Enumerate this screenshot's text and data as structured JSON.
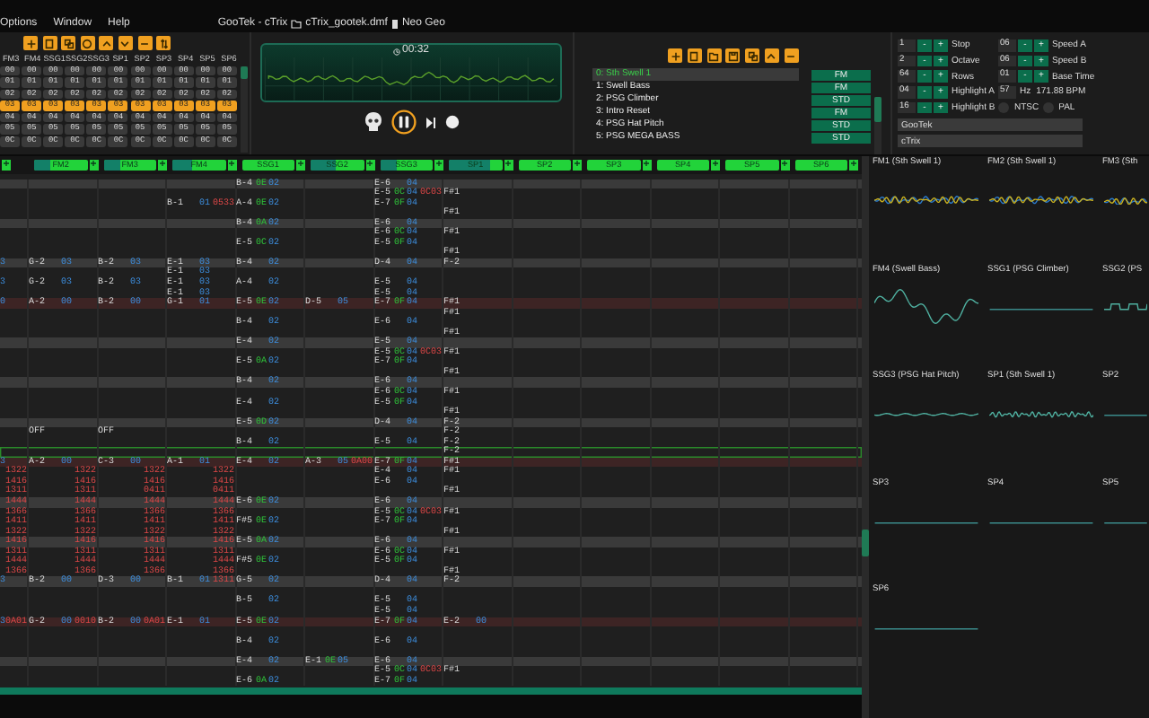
{
  "menu": [
    "Options",
    "Window",
    "Help"
  ],
  "title": {
    "song": "GooTek - cTrix",
    "file": "cTrix_gootek.dmf",
    "system": "Neo Geo"
  },
  "orders": {
    "columns": [
      "FM3",
      "FM4",
      "SSG1",
      "SSG2",
      "SSG3",
      "SP1",
      "SP2",
      "SP3",
      "SP4",
      "SP5",
      "SP6"
    ],
    "rows": [
      {
        "selected": false,
        "cells": [
          "00",
          "00",
          "00",
          "00",
          "00",
          "00",
          "00",
          "00",
          "00",
          "00",
          "00"
        ]
      },
      {
        "selected": false,
        "cells": [
          "01",
          "01",
          "01",
          "01",
          "01",
          "01",
          "01",
          "01",
          "01",
          "01",
          "01"
        ]
      },
      {
        "selected": false,
        "cells": [
          "02",
          "02",
          "02",
          "02",
          "02",
          "02",
          "02",
          "02",
          "02",
          "02",
          "02"
        ]
      },
      {
        "selected": true,
        "cells": [
          "03",
          "03",
          "03",
          "03",
          "03",
          "03",
          "03",
          "03",
          "03",
          "03",
          "03"
        ]
      },
      {
        "selected": false,
        "cells": [
          "04",
          "04",
          "04",
          "04",
          "04",
          "04",
          "04",
          "04",
          "04",
          "04",
          "04"
        ]
      },
      {
        "selected": false,
        "cells": [
          "05",
          "05",
          "05",
          "05",
          "05",
          "05",
          "05",
          "05",
          "05",
          "05",
          "05"
        ]
      },
      {
        "selected": false,
        "cells": [
          "0C",
          "0C",
          "0C",
          "0C",
          "0C",
          "0C",
          "0C",
          "0C",
          "0C",
          "0C",
          "0C"
        ]
      }
    ]
  },
  "oscilloscope": {
    "time": "00:32"
  },
  "transport": {
    "playing": true
  },
  "instruments": [
    {
      "name": "0: Sth Swell 1",
      "type": "FM",
      "selected": true
    },
    {
      "name": "1: Swell Bass",
      "type": "FM",
      "selected": false
    },
    {
      "name": "2: PSG Climber",
      "type": "STD",
      "selected": false
    },
    {
      "name": "3: Intro Reset",
      "type": "FM",
      "selected": false
    },
    {
      "name": "4: PSG Hat Pitch",
      "type": "STD",
      "selected": false
    },
    {
      "name": "5: PSG MEGA BASS",
      "type": "STD",
      "selected": false
    }
  ],
  "settings": {
    "left": [
      {
        "value": "1",
        "label": "Stop"
      },
      {
        "value": "2",
        "label": "Octave"
      },
      {
        "value": "64",
        "label": "Rows"
      },
      {
        "value": "04",
        "label": "Highlight A"
      },
      {
        "value": "16",
        "label": "Highlight B"
      }
    ],
    "right": [
      {
        "kind": "spin",
        "value": "06",
        "label": "Speed A"
      },
      {
        "kind": "spin",
        "value": "06",
        "label": "Speed B"
      },
      {
        "kind": "spin",
        "value": "01",
        "label": "Base Time"
      },
      {
        "kind": "rate",
        "value": "57",
        "unit": "Hz",
        "reading": "171.88 BPM"
      },
      {
        "kind": "radios",
        "options": [
          {
            "label": "NTSC",
            "selected": false
          },
          {
            "label": "PAL",
            "selected": false
          }
        ]
      }
    ],
    "minus": "-",
    "plus": "+",
    "author": "GooTek",
    "name_field": "cTrix"
  },
  "channels": [
    {
      "add": "+"
    },
    {
      "label": "FM2",
      "add": "+",
      "level": 0.3
    },
    {
      "label": "FM3",
      "add": "+",
      "level": 0.3
    },
    {
      "label": "FM4",
      "add": "+",
      "level": 0.35
    },
    {
      "label": "SSG1",
      "add": "+",
      "level": 0
    },
    {
      "label": "SSG2",
      "add": "+",
      "level": 0.45
    },
    {
      "label": "SSG3",
      "add": "+",
      "level": 0.3
    },
    {
      "label": "SP1",
      "add": "+",
      "level": 0.75
    },
    {
      "label": "SP2",
      "add": "+",
      "level": 0
    },
    {
      "label": "SP3",
      "add": "+",
      "level": 0
    },
    {
      "label": "SP4",
      "add": "+",
      "level": 0
    },
    {
      "label": "SP5",
      "add": "+",
      "level": 0
    },
    {
      "label": "SP6",
      "add": "+",
      "level": 0
    }
  ],
  "pattern": [
    {
      "kind": "beat",
      "playing": false,
      "cells": [
        null,
        null,
        null,
        null,
        {
          "note": "B-4",
          "instrument": "0E",
          "volume": "02"
        },
        null,
        {
          "note": "E-6",
          "volume": "04"
        }
      ]
    },
    {
      "kind": "normal",
      "playing": false,
      "cells": [
        null,
        null,
        null,
        null,
        null,
        null,
        {
          "note": "E-5",
          "instrument": "0C",
          "volume": "04",
          "effect": "0C03"
        },
        {
          "note": "F#1"
        }
      ]
    },
    {
      "kind": "normal",
      "playing": false,
      "cells": [
        null,
        null,
        null,
        {
          "note": "B-1",
          "volume": "01",
          "effect": "0533"
        },
        {
          "note": "A-4",
          "instrument": "0E",
          "volume": "02"
        },
        null,
        {
          "note": "E-7",
          "instrument": "0F",
          "volume": "04"
        }
      ]
    },
    {
      "kind": "normal",
      "playing": false,
      "cells": [
        null,
        null,
        null,
        null,
        null,
        null,
        null,
        {
          "note": "F#1"
        }
      ]
    },
    {
      "kind": "beat",
      "playing": false,
      "cells": [
        null,
        null,
        null,
        null,
        {
          "note": "B-4",
          "instrument": "0A",
          "volume": "02"
        },
        null,
        {
          "note": "E-6",
          "volume": "04"
        }
      ]
    },
    {
      "kind": "normal",
      "playing": false,
      "cells": [
        null,
        null,
        null,
        null,
        null,
        null,
        {
          "note": "E-6",
          "instrument": "0C",
          "volume": "04"
        },
        {
          "note": "F#1"
        }
      ]
    },
    {
      "kind": "normal",
      "playing": false,
      "cells": [
        null,
        null,
        null,
        null,
        {
          "note": "E-5",
          "instrument": "0C",
          "volume": "02"
        },
        null,
        {
          "note": "E-5",
          "instrument": "0F",
          "volume": "04"
        }
      ]
    },
    {
      "kind": "normal",
      "playing": false,
      "cells": [
        null,
        null,
        null,
        null,
        null,
        null,
        null,
        {
          "note": "F#1"
        }
      ]
    },
    {
      "kind": "beat",
      "playing": false,
      "cells": [
        {
          "volume": "3"
        },
        {
          "note": "G-2",
          "volume": "03"
        },
        {
          "note": "B-2",
          "volume": "03"
        },
        {
          "note": "E-1",
          "volume": "03"
        },
        {
          "note": "B-4",
          "volume": "02"
        },
        null,
        {
          "note": "D-4",
          "volume": "04"
        },
        {
          "note": "F-2"
        }
      ]
    },
    {
      "kind": "normal",
      "playing": false,
      "cells": [
        null,
        null,
        null,
        {
          "note": "E-1",
          "volume": "03"
        }
      ]
    },
    {
      "kind": "normal",
      "playing": false,
      "cells": [
        {
          "volume": "3"
        },
        {
          "note": "G-2",
          "volume": "03"
        },
        {
          "note": "B-2",
          "volume": "03"
        },
        {
          "note": "E-1",
          "volume": "03"
        },
        {
          "note": "A-4",
          "volume": "02"
        },
        null,
        {
          "note": "E-5",
          "volume": "04"
        }
      ]
    },
    {
      "kind": "normal",
      "playing": false,
      "cells": [
        null,
        null,
        null,
        {
          "note": "E-1",
          "volume": "03"
        },
        null,
        null,
        {
          "note": "E-5",
          "volume": "04"
        }
      ]
    },
    {
      "kind": "bar",
      "playing": false,
      "cells": [
        {
          "volume": "0"
        },
        {
          "note": "A-2",
          "volume": "00"
        },
        {
          "note": "B-2",
          "volume": "00"
        },
        {
          "note": "G-1",
          "volume": "01"
        },
        {
          "note": "E-5",
          "instrument": "0E",
          "volume": "02"
        },
        {
          "note": "D-5",
          "volume": "05"
        },
        {
          "note": "E-7",
          "instrument": "0F",
          "volume": "04"
        },
        {
          "note": "F#1"
        }
      ]
    },
    {
      "kind": "normal",
      "playing": false,
      "cells": [
        null,
        null,
        null,
        null,
        null,
        null,
        null,
        {
          "note": "F#1"
        }
      ]
    },
    {
      "kind": "normal",
      "playing": false,
      "cells": [
        null,
        null,
        null,
        null,
        {
          "note": "B-4",
          "volume": "02"
        },
        null,
        {
          "note": "E-6",
          "volume": "04"
        }
      ]
    },
    {
      "kind": "normal",
      "playing": false,
      "cells": [
        null,
        null,
        null,
        null,
        null,
        null,
        null,
        {
          "note": "F#1"
        }
      ]
    },
    {
      "kind": "beat",
      "playing": false,
      "cells": [
        null,
        null,
        null,
        null,
        {
          "note": "E-4",
          "volume": "02"
        },
        null,
        {
          "note": "E-5",
          "volume": "04"
        }
      ]
    },
    {
      "kind": "normal",
      "playing": false,
      "cells": [
        null,
        null,
        null,
        null,
        null,
        null,
        {
          "note": "E-5",
          "instrument": "0C",
          "volume": "04",
          "effect": "0C03"
        },
        {
          "note": "F#1"
        }
      ]
    },
    {
      "kind": "normal",
      "playing": false,
      "cells": [
        null,
        null,
        null,
        null,
        {
          "note": "E-5",
          "instrument": "0A",
          "volume": "02"
        },
        null,
        {
          "note": "E-7",
          "instrument": "0F",
          "volume": "04"
        }
      ]
    },
    {
      "kind": "normal",
      "playing": false,
      "cells": [
        null,
        null,
        null,
        null,
        null,
        null,
        null,
        {
          "note": "F#1"
        }
      ]
    },
    {
      "kind": "beat",
      "playing": false,
      "cells": [
        null,
        null,
        null,
        null,
        {
          "note": "B-4",
          "volume": "02"
        },
        null,
        {
          "note": "E-6",
          "volume": "04"
        }
      ]
    },
    {
      "kind": "normal",
      "playing": false,
      "cells": [
        null,
        null,
        null,
        null,
        null,
        null,
        {
          "note": "E-6",
          "instrument": "0C",
          "volume": "04"
        },
        {
          "note": "F#1"
        }
      ]
    },
    {
      "kind": "normal",
      "playing": false,
      "cells": [
        null,
        null,
        null,
        null,
        {
          "note": "E-4",
          "volume": "02"
        },
        null,
        {
          "note": "E-5",
          "instrument": "0F",
          "volume": "04"
        }
      ]
    },
    {
      "kind": "normal",
      "playing": false,
      "cells": [
        null,
        null,
        null,
        null,
        null,
        null,
        null,
        {
          "note": "F#1"
        }
      ]
    },
    {
      "kind": "beat",
      "playing": false,
      "cells": [
        null,
        null,
        null,
        null,
        {
          "note": "E-5",
          "instrument": "0D",
          "volume": "02"
        },
        null,
        {
          "note": "D-4",
          "volume": "04"
        },
        {
          "note": "F-2"
        }
      ]
    },
    {
      "kind": "normal",
      "playing": false,
      "cells": [
        null,
        {
          "note": "OFF"
        },
        {
          "note": "OFF"
        },
        null,
        null,
        null,
        null,
        {
          "note": "F-2"
        }
      ]
    },
    {
      "kind": "normal",
      "playing": false,
      "cells": [
        null,
        null,
        null,
        null,
        {
          "note": "B-4",
          "volume": "02"
        },
        null,
        {
          "note": "E-5",
          "volume": "04"
        },
        {
          "note": "F-2"
        }
      ]
    },
    {
      "kind": "normal",
      "playing": true,
      "cells": [
        null,
        null,
        null,
        null,
        null,
        null,
        null,
        {
          "note": "F-2"
        }
      ]
    },
    {
      "kind": "bar",
      "playing": false,
      "cells": [
        {
          "volume": "3"
        },
        {
          "note": "A-2",
          "volume": "00"
        },
        {
          "note": "C-3",
          "volume": "00"
        },
        {
          "note": "A-1",
          "volume": "01"
        },
        {
          "note": "E-4",
          "volume": "02"
        },
        {
          "note": "A-3",
          "volume": "05",
          "effect": "0A00"
        },
        {
          "note": "E-7",
          "instrument": "0F",
          "volume": "04"
        },
        {
          "note": "F#1"
        }
      ]
    },
    {
      "kind": "normal",
      "playing": false,
      "cells": [
        {
          "effect": "1322"
        },
        {
          "effect": "1322"
        },
        {
          "effect": "1322"
        },
        {
          "effect": "1322"
        },
        null,
        null,
        {
          "note": "E-4",
          "volume": "04"
        },
        {
          "note": "F#1"
        }
      ]
    },
    {
      "kind": "normal",
      "playing": false,
      "cells": [
        {
          "effect": "1416"
        },
        {
          "effect": "1416"
        },
        {
          "effect": "1416"
        },
        {
          "effect": "1416"
        },
        null,
        null,
        {
          "note": "E-6",
          "volume": "04"
        }
      ]
    },
    {
      "kind": "normal",
      "playing": false,
      "cells": [
        {
          "effect": "1311"
        },
        {
          "effect": "1311"
        },
        {
          "effect": "0411"
        },
        {
          "effect": "0411"
        },
        null,
        null,
        null,
        {
          "note": "F#1"
        }
      ]
    },
    {
      "kind": "beat",
      "playing": false,
      "cells": [
        {
          "effect": "1444"
        },
        {
          "effect": "1444"
        },
        {
          "effect": "1444"
        },
        {
          "effect": "1444"
        },
        {
          "note": "E-6",
          "instrument": "0E",
          "volume": "02"
        },
        null,
        {
          "note": "E-6",
          "volume": "04"
        }
      ]
    },
    {
      "kind": "normal",
      "playing": false,
      "cells": [
        {
          "effect": "1366"
        },
        {
          "effect": "1366"
        },
        {
          "effect": "1366"
        },
        {
          "effect": "1366"
        },
        null,
        null,
        {
          "note": "E-5",
          "instrument": "0C",
          "volume": "04",
          "effect": "0C03"
        },
        {
          "note": "F#1"
        }
      ]
    },
    {
      "kind": "normal",
      "playing": false,
      "cells": [
        {
          "effect": "1411"
        },
        {
          "effect": "1411"
        },
        {
          "effect": "1411"
        },
        {
          "effect": "1411"
        },
        {
          "note": "F#5",
          "instrument": "0E",
          "volume": "02"
        },
        null,
        {
          "note": "E-7",
          "instrument": "0F",
          "volume": "04"
        }
      ]
    },
    {
      "kind": "normal",
      "playing": false,
      "cells": [
        {
          "effect": "1322"
        },
        {
          "effect": "1322"
        },
        {
          "effect": "1322"
        },
        {
          "effect": "1322"
        },
        null,
        null,
        null,
        {
          "note": "F#1"
        }
      ]
    },
    {
      "kind": "beat",
      "playing": false,
      "cells": [
        {
          "effect": "1416"
        },
        {
          "effect": "1416"
        },
        {
          "effect": "1416"
        },
        {
          "effect": "1416"
        },
        {
          "note": "E-5",
          "instrument": "0A",
          "volume": "02"
        },
        null,
        {
          "note": "E-6",
          "volume": "04"
        }
      ]
    },
    {
      "kind": "normal",
      "playing": false,
      "cells": [
        {
          "effect": "1311"
        },
        {
          "effect": "1311"
        },
        {
          "effect": "1311"
        },
        {
          "effect": "1311"
        },
        null,
        null,
        {
          "note": "E-6",
          "instrument": "0C",
          "volume": "04"
        },
        {
          "note": "F#1"
        }
      ]
    },
    {
      "kind": "normal",
      "playing": false,
      "cells": [
        {
          "effect": "1444"
        },
        {
          "effect": "1444"
        },
        {
          "effect": "1444"
        },
        {
          "effect": "1444"
        },
        {
          "note": "F#5",
          "instrument": "0E",
          "volume": "02"
        },
        null,
        {
          "note": "E-5",
          "instrument": "0F",
          "volume": "04"
        }
      ]
    },
    {
      "kind": "normal",
      "playing": false,
      "cells": [
        {
          "effect": "1366"
        },
        {
          "effect": "1366"
        },
        {
          "effect": "1366"
        },
        {
          "effect": "1366"
        },
        null,
        null,
        null,
        {
          "note": "F#1"
        }
      ]
    },
    {
      "kind": "beat",
      "playing": false,
      "cells": [
        {
          "volume": "3"
        },
        {
          "note": "B-2",
          "volume": "00"
        },
        {
          "note": "D-3",
          "volume": "00"
        },
        {
          "note": "B-1",
          "volume": "01",
          "effect": "1311"
        },
        {
          "note": "G-5",
          "volume": "02"
        },
        null,
        {
          "note": "D-4",
          "volume": "04"
        },
        {
          "note": "F-2"
        }
      ]
    },
    {
      "kind": "normal",
      "playing": false
    },
    {
      "kind": "normal",
      "playing": false,
      "cells": [
        null,
        null,
        null,
        null,
        {
          "note": "B-5",
          "volume": "02"
        },
        null,
        {
          "note": "E-5",
          "volume": "04"
        }
      ]
    },
    {
      "kind": "normal",
      "playing": false,
      "cells": [
        null,
        null,
        null,
        null,
        null,
        null,
        {
          "note": "E-5",
          "volume": "04"
        }
      ]
    },
    {
      "kind": "bar",
      "playing": false,
      "cells": [
        {
          "volume": "3",
          "effect": "0A01"
        },
        {
          "note": "G-2",
          "volume": "00",
          "effect": "0010"
        },
        {
          "note": "B-2",
          "volume": "00",
          "effect": "0A01"
        },
        {
          "note": "E-1",
          "volume": "01"
        },
        {
          "note": "E-5",
          "instrument": "0E",
          "volume": "02"
        },
        null,
        {
          "note": "E-7",
          "instrument": "0F",
          "volume": "04"
        },
        {
          "note": "E-2",
          "volume": "00"
        }
      ]
    },
    {
      "kind": "normal",
      "playing": false
    },
    {
      "kind": "normal",
      "playing": false,
      "cells": [
        null,
        null,
        null,
        null,
        {
          "note": "B-4",
          "volume": "02"
        },
        null,
        {
          "note": "E-6",
          "volume": "04"
        }
      ]
    },
    {
      "kind": "normal",
      "playing": false
    },
    {
      "kind": "beat",
      "playing": false,
      "cells": [
        null,
        null,
        null,
        null,
        {
          "note": "E-4",
          "volume": "02"
        },
        {
          "note": "E-1",
          "instrument": "0E",
          "volume": "05"
        },
        {
          "note": "E-6",
          "volume": "04"
        }
      ]
    },
    {
      "kind": "normal",
      "playing": false,
      "cells": [
        null,
        null,
        null,
        null,
        null,
        null,
        {
          "note": "E-5",
          "instrument": "0C",
          "volume": "04",
          "effect": "0C03"
        },
        {
          "note": "F#1"
        }
      ]
    },
    {
      "kind": "normal",
      "playing": false,
      "cells": [
        null,
        null,
        null,
        null,
        {
          "note": "E-6",
          "instrument": "0A",
          "volume": "02"
        },
        null,
        {
          "note": "E-7",
          "instrument": "0F",
          "volume": "04"
        }
      ]
    }
  ],
  "scopes": [
    {
      "label": "FM1 (Sth Swell 1)",
      "kind": "busy"
    },
    {
      "label": "FM2 (Sth Swell 1)",
      "kind": "busy"
    },
    {
      "label": "FM3 (Sth",
      "kind": "busy"
    },
    {
      "label": "FM4 (Swell Bass)",
      "kind": "big"
    },
    {
      "label": "SSG1 (PSG Climber)",
      "kind": "flat"
    },
    {
      "label": "SSG2 (PS",
      "kind": "pulse"
    },
    {
      "label": "SSG3 (PSG Hat Pitch)",
      "kind": "ripple"
    },
    {
      "label": "SP1 (Sth Swell 1)",
      "kind": "jitter"
    },
    {
      "label": "SP2",
      "kind": "flat"
    },
    {
      "label": "SP3",
      "kind": "flat"
    },
    {
      "label": "SP4",
      "kind": "flat"
    },
    {
      "label": "SP5",
      "kind": "flat"
    },
    {
      "label": "SP6",
      "kind": "flat"
    }
  ]
}
